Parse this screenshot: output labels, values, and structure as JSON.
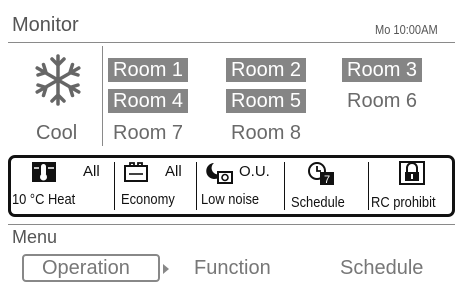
{
  "header": {
    "title": "Monitor",
    "datetime": "Mo 10:00AM"
  },
  "mode": {
    "label": "Cool",
    "icon": "snowflake-icon"
  },
  "rooms": [
    {
      "label": "Room 1",
      "active": true
    },
    {
      "label": "Room 2",
      "active": true
    },
    {
      "label": "Room 3",
      "active": true
    },
    {
      "label": "Room 4",
      "active": true
    },
    {
      "label": "Room 5",
      "active": true
    },
    {
      "label": "Room 6",
      "active": false
    },
    {
      "label": "Room 7",
      "active": false
    },
    {
      "label": "Room 8",
      "active": false
    }
  ],
  "status_bar": [
    {
      "icon": "heat-thermometer-icon",
      "tag": "All",
      "label": "10 °C Heat"
    },
    {
      "icon": "economy-icon",
      "tag": "All",
      "label": "Economy"
    },
    {
      "icon": "low-noise-moon-icon",
      "tag": "O.U.",
      "label": "Low noise"
    },
    {
      "icon": "schedule-clock-icon",
      "tag": "",
      "label": "Schedule"
    },
    {
      "icon": "padlock-icon",
      "tag": "",
      "label": "RC prohibit"
    }
  ],
  "menu": {
    "label": "Menu",
    "tabs": [
      {
        "label": "Operation",
        "selected": true
      },
      {
        "label": "Function",
        "selected": false
      },
      {
        "label": "Schedule",
        "selected": false
      }
    ]
  },
  "colors": {
    "active_room_bg": "#858585",
    "text": "#555555",
    "border": "#111111"
  }
}
